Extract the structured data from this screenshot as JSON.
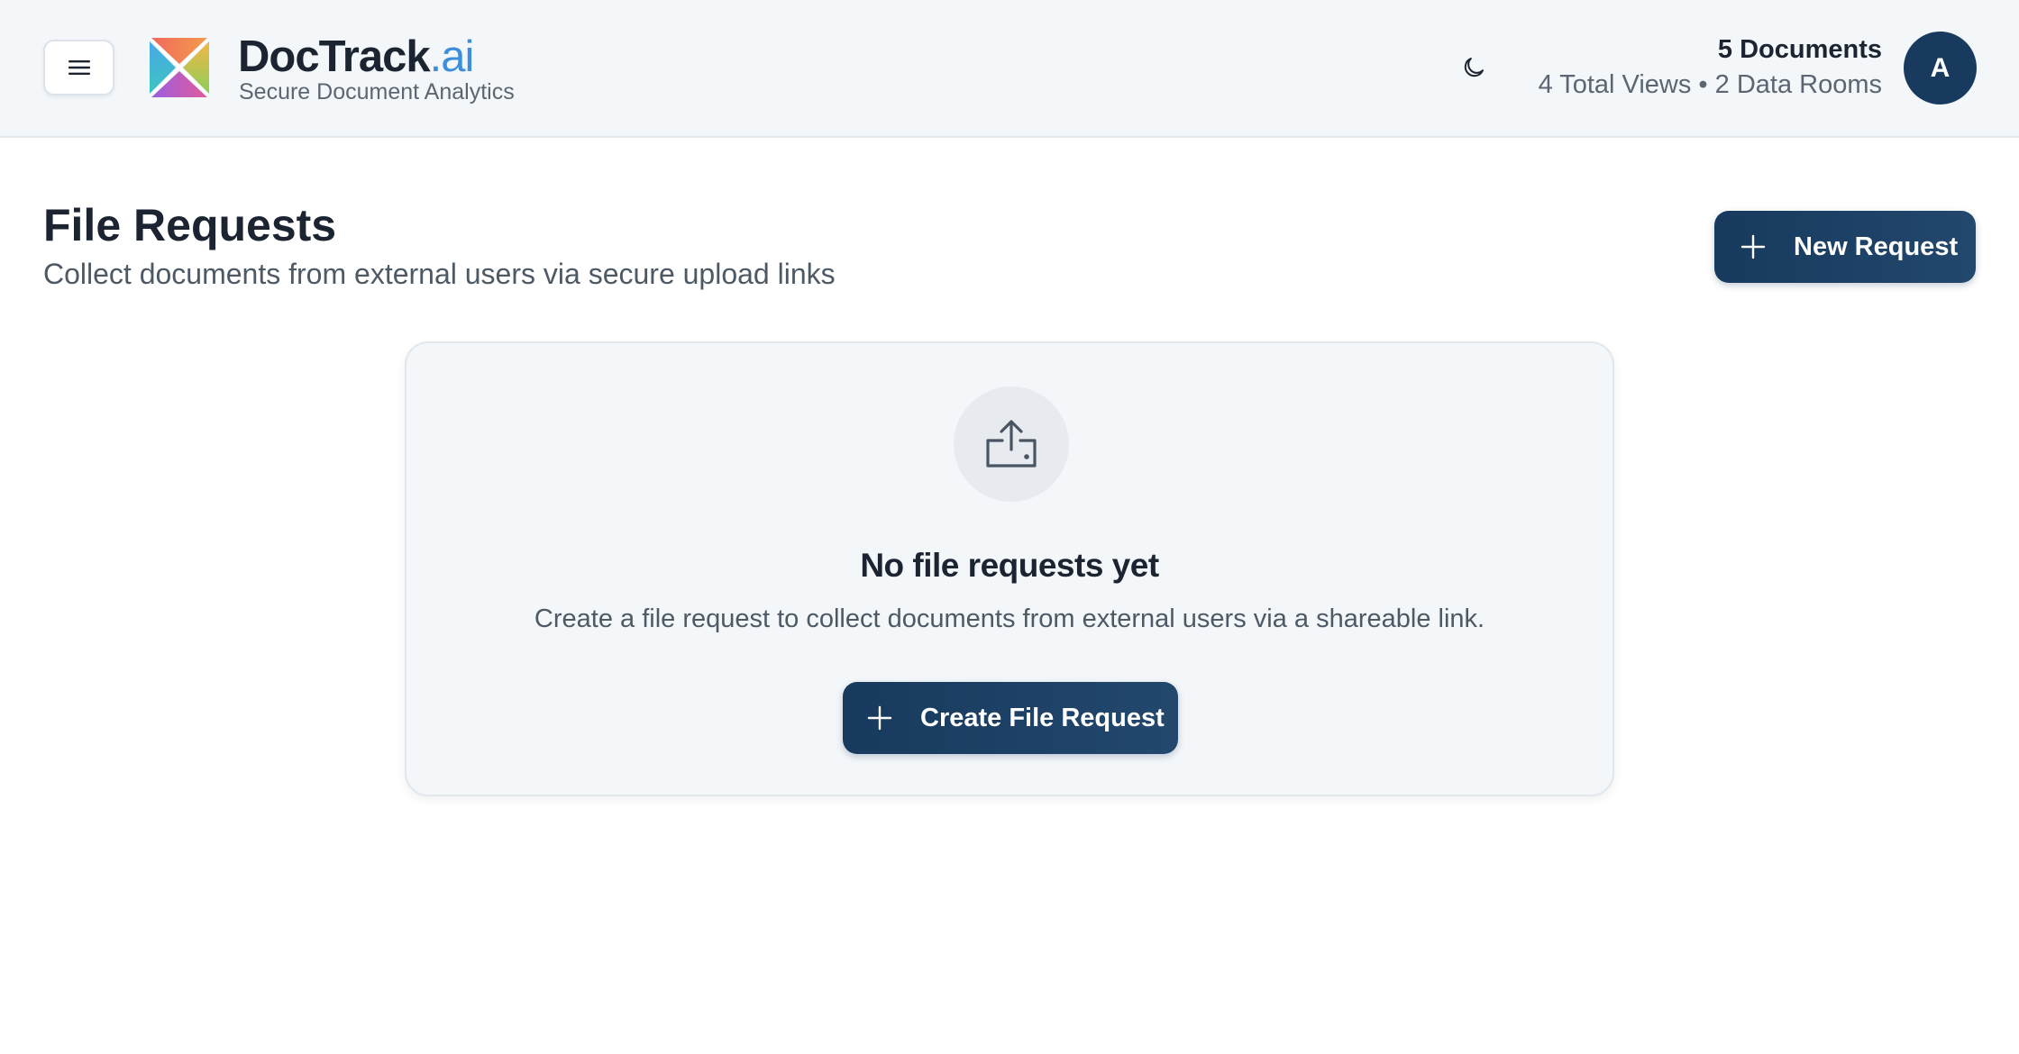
{
  "header": {
    "brand_name": "DocTrack",
    "brand_suffix": ".ai",
    "tagline": "Secure Document Analytics",
    "documents": "5 Documents",
    "summary": "4 Total Views • 2 Data Rooms",
    "avatar_initial": "A"
  },
  "page": {
    "title": "File Requests",
    "subtitle": "Collect documents from external users via secure upload links",
    "new_request_label": "New Request"
  },
  "empty_state": {
    "title": "No file requests yet",
    "description": "Create a file request to collect documents from external users via a shareable link.",
    "button_label": "Create File Request"
  },
  "icons": {
    "menu": "hamburger-icon",
    "logo": "doctrack-logo",
    "theme": "moon-icon",
    "new_request": "plus-icon",
    "empty": "upload-tray-icon",
    "create": "plus-icon"
  },
  "colors": {
    "primary": "#173a5e",
    "brand_accent": "#3d8fdc",
    "header_bg": "#f4f7fa",
    "text_primary": "#1b2430",
    "text_muted": "#4e5966"
  }
}
